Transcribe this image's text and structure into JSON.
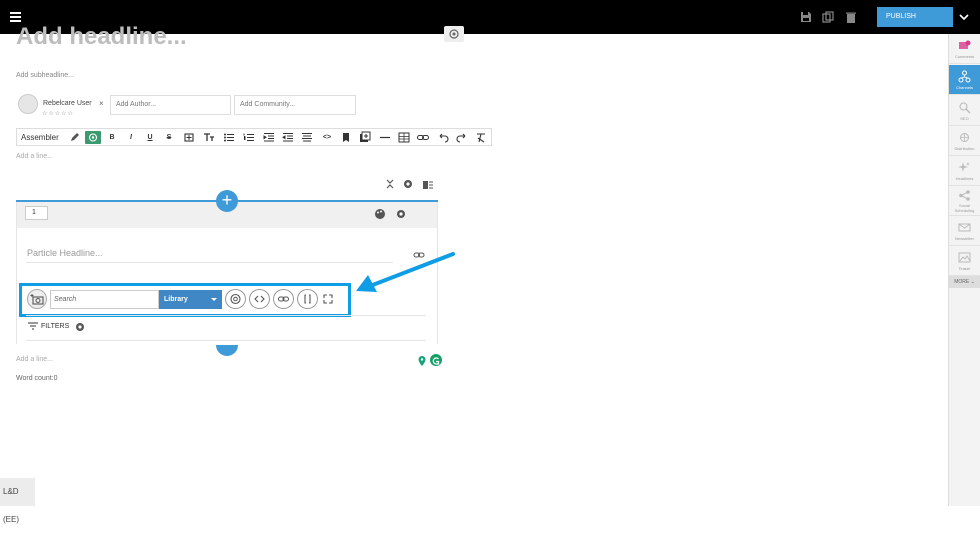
{
  "topbar": {
    "publish_label": "PUBLISH"
  },
  "editor": {
    "headline_placeholder": "Add headline...",
    "subheadline_placeholder": "Add subheadline...",
    "author_name": "Rebelcare User",
    "author_rating": "☆☆☆☆☆",
    "author_remove": "×",
    "add_author_placeholder": "Add Author...",
    "add_community_placeholder": "Add Community...",
    "toolbar_label": "Assembler",
    "add_line_placeholder": "Add a line...",
    "word_count": "Word count:0"
  },
  "particle": {
    "number": "1",
    "headline_placeholder": "Particle Headline...",
    "search_placeholder": "Search",
    "library_label": "Library",
    "filters_label": "FILTERS"
  },
  "sidebar": {
    "items": [
      {
        "label": "Comments",
        "icon": "comments-icon"
      },
      {
        "label": "Channels",
        "icon": "channels-icon"
      },
      {
        "label": "SEO",
        "icon": "seo-icon"
      },
      {
        "label": "Distribution",
        "icon": "distribution-icon"
      },
      {
        "label": "Headlines",
        "icon": "headlines-icon"
      },
      {
        "label": "Social Scheduling",
        "icon": "share-icon"
      },
      {
        "label": "Newsletter",
        "icon": "mail-icon"
      },
      {
        "label": "Teaser",
        "icon": "image-icon"
      }
    ],
    "more_label": "MORE"
  },
  "footer": {
    "tag": "L&D (EE)"
  },
  "colors": {
    "accent": "#3f9ad8",
    "highlight": "#0f9ee6",
    "ai_green": "#3b9b6f"
  }
}
